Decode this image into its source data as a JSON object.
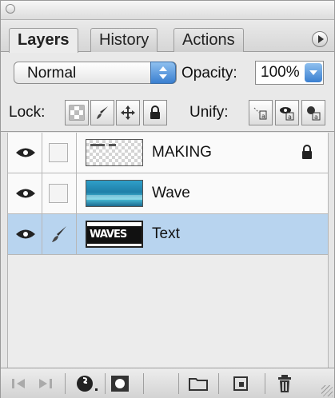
{
  "tabs": [
    {
      "label": "Layers",
      "active": true
    },
    {
      "label": "History",
      "active": false
    },
    {
      "label": "Actions",
      "active": false
    }
  ],
  "blend": {
    "mode": "Normal",
    "opacity_label": "Opacity:",
    "opacity_value": "100%"
  },
  "lock": {
    "label": "Lock:",
    "unify_label": "Unify:"
  },
  "layers": [
    {
      "name": "MAKING",
      "visible": true,
      "locked": true,
      "thumbnail": "transparent-icon"
    },
    {
      "name": "Wave",
      "visible": true,
      "locked": false,
      "thumbnail": "wave-image"
    },
    {
      "name": "Text",
      "visible": true,
      "locked": false,
      "selected": true,
      "thumbnail": "text-image",
      "thumb_text": "WAVES"
    }
  ],
  "icons": {
    "panel_menu": "panel-menu-arrow-icon",
    "eye": "eye-icon",
    "brush": "brush-icon",
    "lock_transparent": "lock-transparent-pixels-icon",
    "lock_image": "lock-image-pixels-icon",
    "lock_position": "lock-position-icon",
    "lock_all": "lock-all-icon",
    "unify_position": "unify-position-icon",
    "unify_visibility": "unify-visibility-icon",
    "unify_style": "unify-style-icon",
    "toolbar": [
      "previous-frame-icon",
      "next-frame-icon",
      "layer-style-icon",
      "layer-mask-icon",
      "new-group-icon",
      "new-layer-icon",
      "trash-icon"
    ]
  },
  "colors": {
    "selection": "#b8d4ef",
    "accent_blue": "#3a7fd0"
  }
}
